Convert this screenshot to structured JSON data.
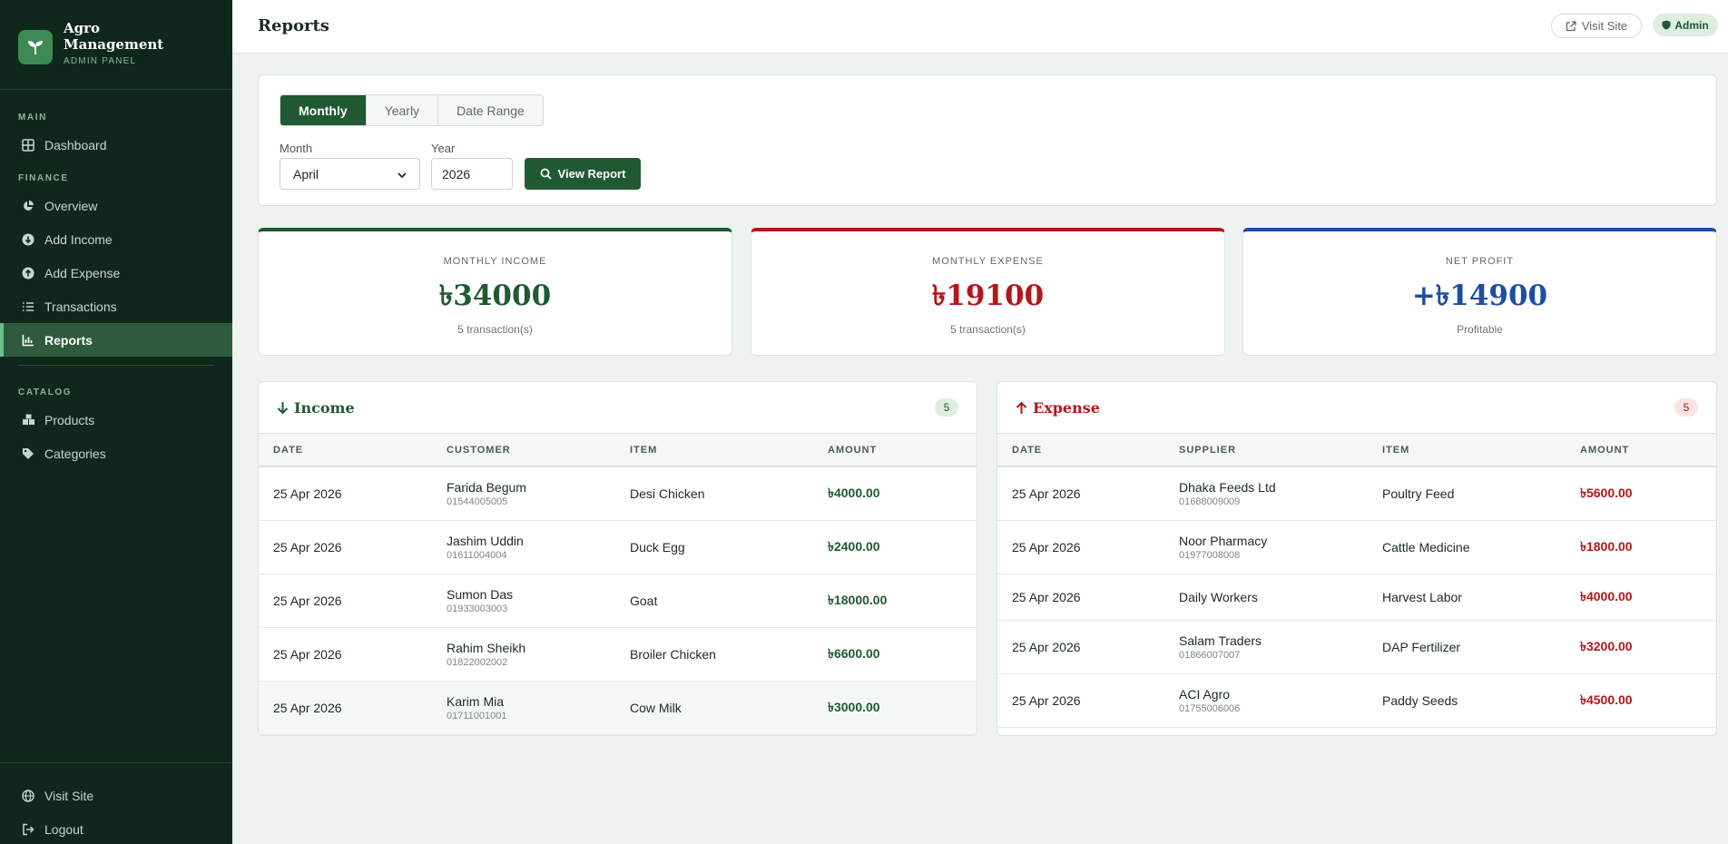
{
  "brand": {
    "title_line1": "Agro",
    "title_line2": "Management",
    "subtitle": "ADMIN PANEL"
  },
  "sidebar": {
    "main_label": "MAIN",
    "finance_label": "FINANCE",
    "catalog_label": "CATALOG",
    "items": {
      "dashboard": "Dashboard",
      "overview": "Overview",
      "add_income": "Add Income",
      "add_expense": "Add Expense",
      "transactions": "Transactions",
      "reports": "Reports",
      "products": "Products",
      "categories": "Categories",
      "visit_site": "Visit Site",
      "logout": "Logout"
    }
  },
  "header": {
    "title": "Reports",
    "visit_site": "Visit Site",
    "admin": "Admin"
  },
  "filter": {
    "tabs": [
      "Monthly",
      "Yearly",
      "Date Range"
    ],
    "active_tab": "Monthly",
    "month_label": "Month",
    "month_value": "April",
    "year_label": "Year",
    "year_value": "2026",
    "view_button": "View Report"
  },
  "stats": {
    "income": {
      "label": "MONTHLY INCOME",
      "value": "৳34000",
      "sub": "5 transaction(s)",
      "color": "#1f5a33"
    },
    "expense": {
      "label": "MONTHLY EXPENSE",
      "value": "৳19100",
      "sub": "5 transaction(s)",
      "color": "#b3161b"
    },
    "profit": {
      "label": "NET PROFIT",
      "value": "+৳14900",
      "sub": "Profitable",
      "color": "#1d4fa0"
    }
  },
  "income_table": {
    "title": "Income",
    "count": "5",
    "headers": [
      "DATE",
      "CUSTOMER",
      "ITEM",
      "AMOUNT"
    ],
    "rows": [
      {
        "date": "25 Apr 2026",
        "name": "Farida Begum",
        "phone": "01544005005",
        "item": "Desi Chicken",
        "amount": "৳4000.00"
      },
      {
        "date": "25 Apr 2026",
        "name": "Jashim Uddin",
        "phone": "01611004004",
        "item": "Duck Egg",
        "amount": "৳2400.00"
      },
      {
        "date": "25 Apr 2026",
        "name": "Sumon Das",
        "phone": "01933003003",
        "item": "Goat",
        "amount": "৳18000.00"
      },
      {
        "date": "25 Apr 2026",
        "name": "Rahim Sheikh",
        "phone": "01822002002",
        "item": "Broiler Chicken",
        "amount": "৳6600.00"
      },
      {
        "date": "25 Apr 2026",
        "name": "Karim Mia",
        "phone": "01711001001",
        "item": "Cow Milk",
        "amount": "৳3000.00"
      }
    ]
  },
  "expense_table": {
    "title": "Expense",
    "count": "5",
    "headers": [
      "DATE",
      "SUPPLIER",
      "ITEM",
      "AMOUNT"
    ],
    "rows": [
      {
        "date": "25 Apr 2026",
        "name": "Dhaka Feeds Ltd",
        "phone": "01688009009",
        "item": "Poultry Feed",
        "amount": "৳5600.00"
      },
      {
        "date": "25 Apr 2026",
        "name": "Noor Pharmacy",
        "phone": "01977008008",
        "item": "Cattle Medicine",
        "amount": "৳1800.00"
      },
      {
        "date": "25 Apr 2026",
        "name": "Daily Workers",
        "phone": "",
        "item": "Harvest Labor",
        "amount": "৳4000.00"
      },
      {
        "date": "25 Apr 2026",
        "name": "Salam Traders",
        "phone": "01866007007",
        "item": "DAP Fertilizer",
        "amount": "৳3200.00"
      },
      {
        "date": "25 Apr 2026",
        "name": "ACI Agro",
        "phone": "01755006006",
        "item": "Paddy Seeds",
        "amount": "৳4500.00"
      }
    ]
  },
  "colors": {
    "sidebar_bg": "#10281c",
    "accent": "#1f5a33",
    "income": "#1f5a33",
    "expense": "#b3161b",
    "profit": "#1d4fa0"
  }
}
